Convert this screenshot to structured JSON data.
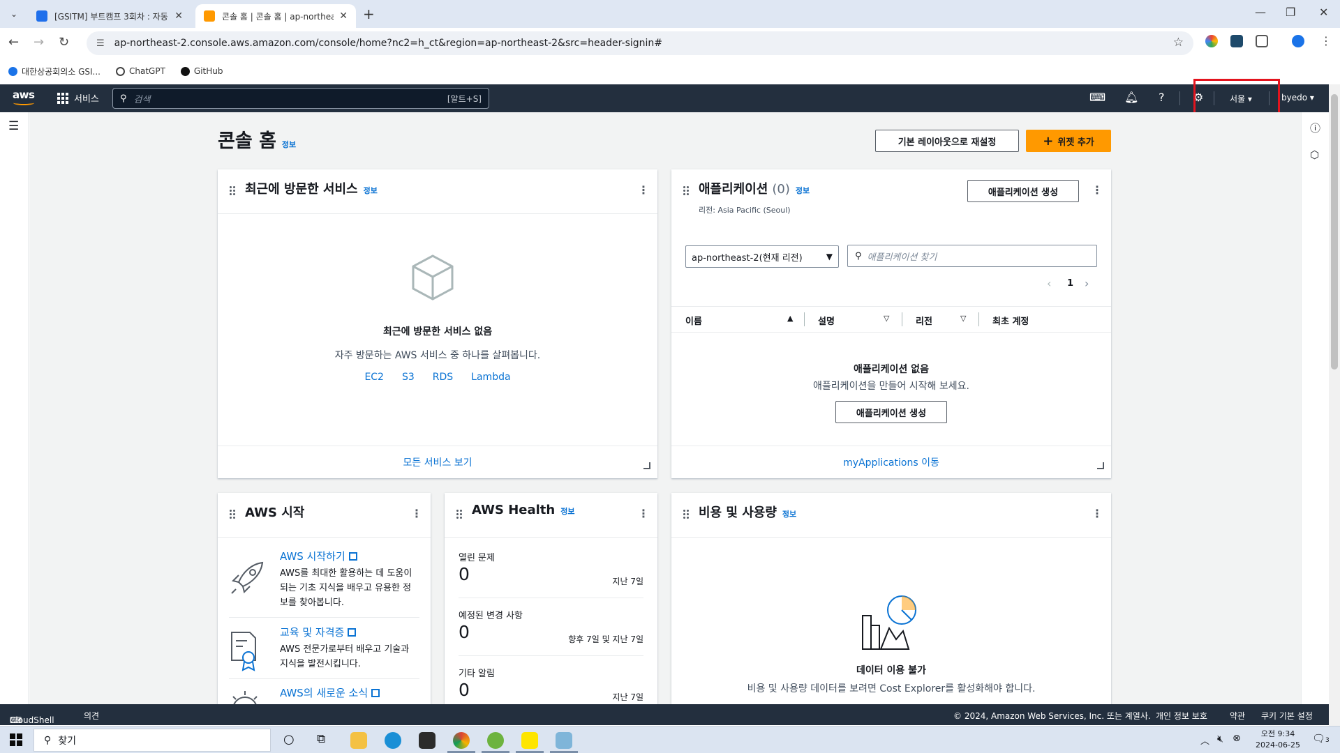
{
  "browser": {
    "tabs": [
      {
        "title": "[GSITM] 부트캠프 3회차 : 자동",
        "favicon_color": "#1f6feb"
      },
      {
        "title": "콘솔 홈 | 콘솔 홈 | ap-northeast",
        "favicon_color": "#ff9900"
      }
    ],
    "url": "ap-northeast-2.console.aws.amazon.com/console/home?nc2=h_ct&region=ap-northeast-2&src=header-signin#",
    "bookmarks": [
      {
        "label": "대한상공회의소 GSI...",
        "color": "#1a73e8"
      },
      {
        "label": "ChatGPT",
        "color": "#444444"
      },
      {
        "label": "GitHub",
        "color": "#111111"
      }
    ]
  },
  "aws_nav": {
    "logo": "aws",
    "services_label": "서비스",
    "search_placeholder": "검색",
    "search_shortcut": "[알트+S]",
    "region_label": "서울",
    "account_label": "byedo"
  },
  "page": {
    "title": "콘솔 홈",
    "title_info": "정보",
    "reset_layout_label": "기본 레이아웃으로 재설정",
    "add_widget_label": "위젯 추가"
  },
  "recent_services": {
    "title": "최근에 방문한 서비스",
    "info": "정보",
    "empty_title": "최근에 방문한 서비스 없음",
    "empty_desc": "자주 방문하는 AWS 서비스 중 하나를 살펴봅니다.",
    "links": [
      "EC2",
      "S3",
      "RDS",
      "Lambda"
    ],
    "footer_link": "모든 서비스 보기"
  },
  "applications": {
    "title": "애플리케이션",
    "count": "(0)",
    "info": "정보",
    "create_label": "애플리케이션 생성",
    "region_text": "리전: Asia Pacific (Seoul)",
    "region_select": "ap-northeast-2(현재 리전)",
    "search_placeholder": "애플리케이션 찾기",
    "page_number": "1",
    "columns": [
      "이름",
      "설명",
      "리전",
      "최초 계정"
    ],
    "empty_title": "애플리케이션 없음",
    "empty_desc": "애플리케이션을 만들어 시작해 보세요.",
    "empty_create_label": "애플리케이션 생성",
    "footer_link": "myApplications 이동"
  },
  "aws_start": {
    "title": "AWS 시작",
    "items": [
      {
        "title": "AWS 시작하기",
        "desc": "AWS를 최대한 활용하는 데 도움이 되는 기초 지식을 배우고 유용한 정보를 찾아봅니다."
      },
      {
        "title": "교육 및 자격증",
        "desc": "AWS 전문가로부터 배우고 기술과 지식을 발전시킵니다."
      },
      {
        "title": "AWS의 새로운 소식",
        "desc": ""
      }
    ]
  },
  "aws_health": {
    "title": "AWS Health",
    "info": "정보",
    "rows": [
      {
        "label": "열린 문제",
        "value": "0",
        "range": "지난 7일"
      },
      {
        "label": "예정된 변경 사항",
        "value": "0",
        "range": "향후 7일 및 지난 7일"
      },
      {
        "label": "기타 알림",
        "value": "0",
        "range": "지난 7일"
      }
    ]
  },
  "cost": {
    "title": "비용 및 사용량",
    "info": "정보",
    "empty_title": "데이터 이용 불가",
    "empty_desc": "비용 및 사용량 데이터를 보려면 Cost Explorer를 활성화해야 합니다."
  },
  "aws_footer": {
    "cloudshell": "CloudShell",
    "feedback": "의견",
    "copyright": "© 2024, Amazon Web Services, Inc. 또는 계열사.",
    "privacy": "개인 정보 보호",
    "terms": "약관",
    "cookies": "쿠키 기본 설정"
  },
  "taskbar": {
    "search_label": "찾기",
    "time": "오전 9:34",
    "date": "2024-06-25",
    "notification_count": "3"
  },
  "colors": {
    "aws_nav": "#232f3e",
    "accent_orange": "#ff9900",
    "link_blue": "#0972d3",
    "highlight_red": "#e3141e"
  }
}
